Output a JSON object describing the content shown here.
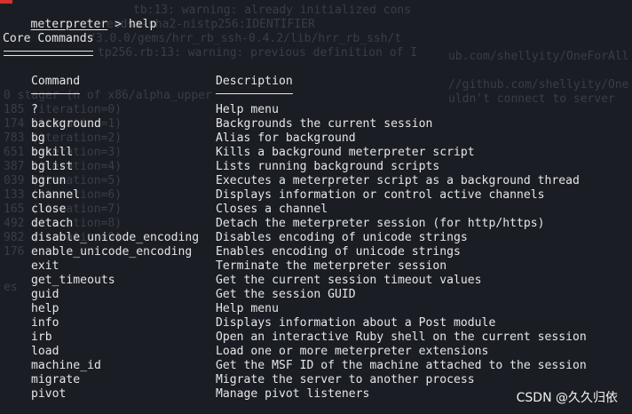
{
  "prompt": {
    "name": "meterpreter",
    "symbol": ">",
    "command": "help"
  },
  "section": {
    "title": "Core Commands"
  },
  "table": {
    "headers": {
      "command": "Command",
      "description": "Description"
    },
    "rows": [
      {
        "command": "?",
        "description": "Help menu"
      },
      {
        "command": "background",
        "description": "Backgrounds the current session"
      },
      {
        "command": "bg",
        "description": "Alias for background"
      },
      {
        "command": "bgkill",
        "description": "Kills a background meterpreter script"
      },
      {
        "command": "bglist",
        "description": "Lists running background scripts"
      },
      {
        "command": "bgrun",
        "description": "Executes a meterpreter script as a background thread"
      },
      {
        "command": "channel",
        "description": "Displays information or control active channels"
      },
      {
        "command": "close",
        "description": "Closes a channel"
      },
      {
        "command": "detach",
        "description": "Detach the meterpreter session (for http/https)"
      },
      {
        "command": "disable_unicode_encoding",
        "description": "Disables encoding of unicode strings"
      },
      {
        "command": "enable_unicode_encoding",
        "description": "Enables encoding of unicode strings"
      },
      {
        "command": "exit",
        "description": "Terminate the meterpreter session"
      },
      {
        "command": "get_timeouts",
        "description": "Get the current session timeout values"
      },
      {
        "command": "guid",
        "description": "Get the session GUID"
      },
      {
        "command": "help",
        "description": "Help menu"
      },
      {
        "command": "info",
        "description": "Displays information about a Post module"
      },
      {
        "command": "irb",
        "description": "Open an interactive Ruby shell on the current session"
      },
      {
        "command": "load",
        "description": "Load one or more meterpreter extensions"
      },
      {
        "command": "machine_id",
        "description": "Get the MSF ID of the machine attached to the session"
      },
      {
        "command": "migrate",
        "description": "Migrate the server to another process"
      },
      {
        "command": "pivot",
        "description": "Manage pivot listeners"
      }
    ]
  },
  "watermark": "CSDN @久久归依",
  "colors": {
    "background": "#1b1d24",
    "text": "#e6e6e6",
    "ghost_text": "#3a3d47",
    "accent_red": "#d4322c"
  }
}
